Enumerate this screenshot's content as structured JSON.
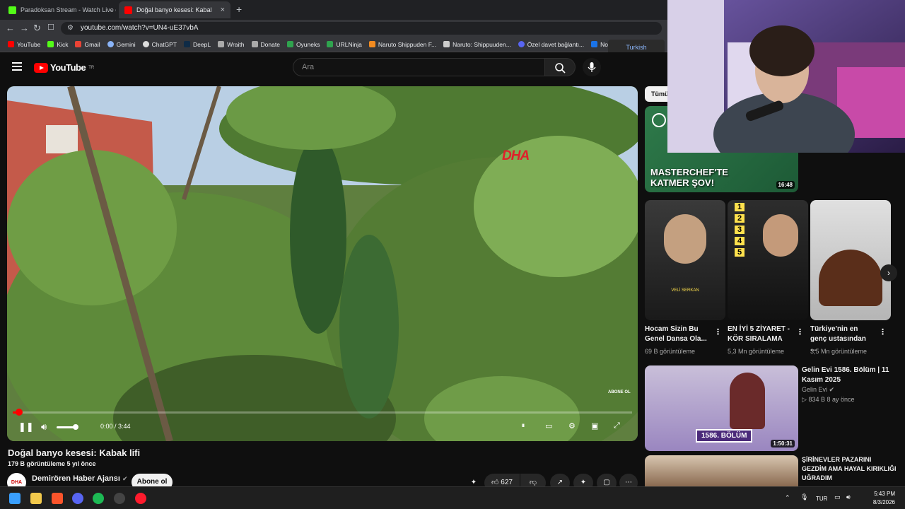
{
  "browser": {
    "tabs": [
      {
        "title": "Paradoksan Stream - Watch Live on K",
        "active": false
      },
      {
        "title": "Doğal banyo kesesi: Kabak lifi",
        "active": true
      }
    ],
    "url": "youtube.com/watch?v=UN4-uE37vbA",
    "bookmarks": [
      "YouTube",
      "Kick",
      "Gmail",
      "Gemini",
      "ChatGPT",
      "DeepL",
      "Wraith",
      "Donate",
      "Oyuneks",
      "URLNinja",
      "Naruto Shippuden F...",
      "Naruto: Shippuuden...",
      "Özel davet bağlantı...",
      "NoT"
    ],
    "translate_label": "Turkish"
  },
  "youtube": {
    "logo_text": "YouTube",
    "logo_region": "TR",
    "search_placeholder": "Ara"
  },
  "player": {
    "watermark": "DHA",
    "subscribe_overlay": "ABONE OL",
    "time": "0:00 / 3:44",
    "progress": 0.01
  },
  "video": {
    "title": "Doğal banyo kesesi: Kabak lifi",
    "meta": "179 B görüntüleme  5 yıl önce",
    "channel": "Demirören Haber Ajansı",
    "channel_avatar": "DHA",
    "subscribe": "Abone ol",
    "likes": "627"
  },
  "sidebar": {
    "chip": "Tümü",
    "top_video": {
      "overlay": "MASTERCHEF'TE KATMER ŞOV!",
      "duration": "16:48"
    },
    "shorts": [
      {
        "title": "Hocam Sizin Bu Genel Dansa Ola...",
        "views": "69 B görüntüleme",
        "caption": "VELİ SERKAN"
      },
      {
        "title": "EN İYİ 5 ZİYARET - KÖR SIRALAMA",
        "views": "5,3 Mn görüntüleme",
        "ranks": [
          "1",
          "2",
          "3",
          "4",
          "5"
        ]
      },
      {
        "title": "Türkiye'nin en genç ustasından ...",
        "views": "3,5 Mn görüntüleme"
      }
    ],
    "videos": [
      {
        "title": "Gelin Evi 1586. Bölüm | 11 Kasım 2025",
        "channel": "Gelin Evi",
        "meta": "834 B  8 ay önce",
        "duration": "1:50:31",
        "overlay": "1586. BÖLÜM"
      },
      {
        "title": "ŞİRİNEVLER PAZARINI GEZDİM AMA HAYAL KIRIKLIĞI UĞRADIM",
        "channel": "",
        "meta": "",
        "duration": "",
        "overlay": ""
      }
    ]
  },
  "taskbar": {
    "lang": "TUR",
    "time": "5:43 PM",
    "date": "8/3/2026"
  }
}
